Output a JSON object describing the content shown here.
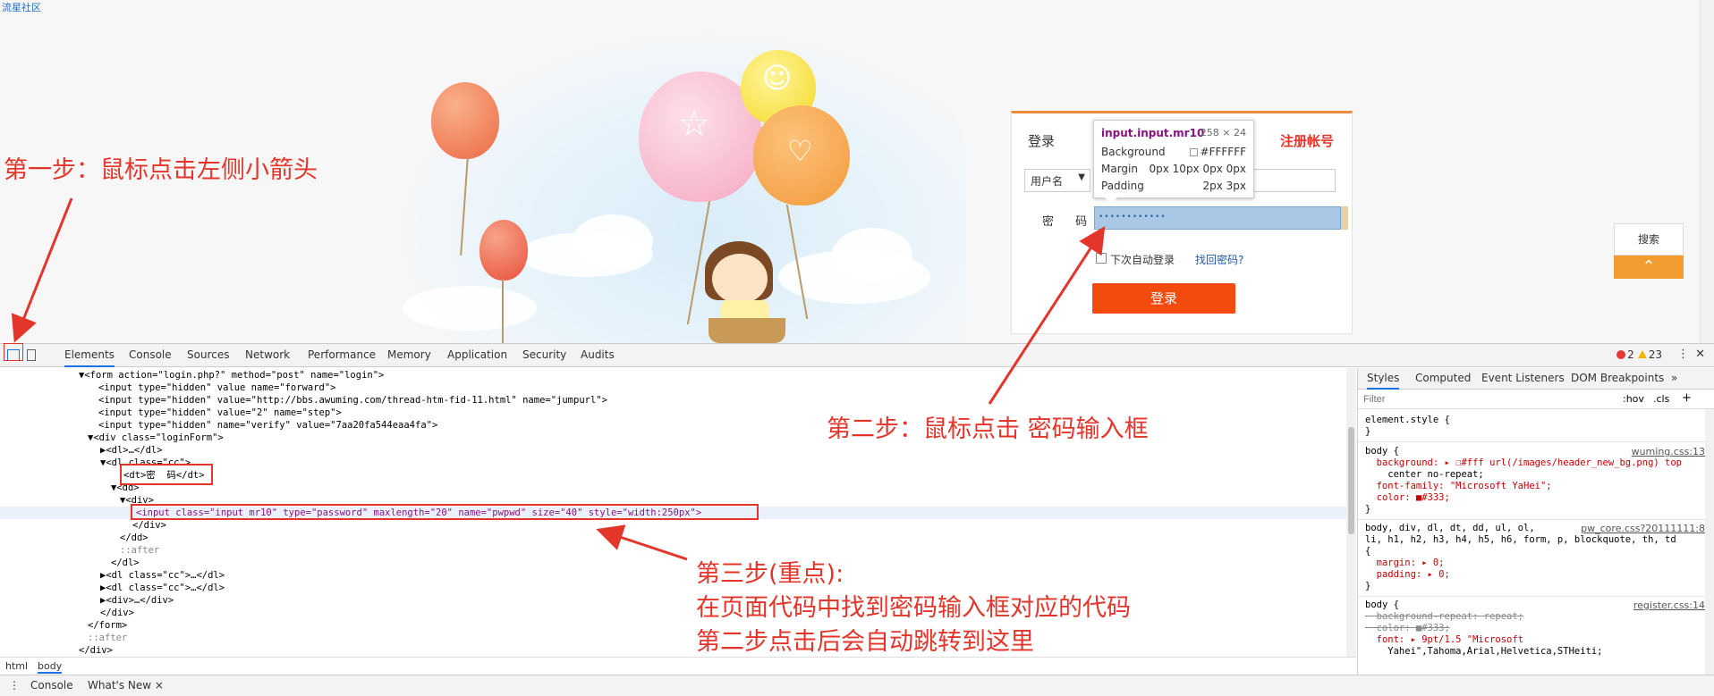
{
  "site": {
    "link_text": "流星社区"
  },
  "login": {
    "title": "登录",
    "register": "注册帐号",
    "select_value": "用户名",
    "password_label": "密 码",
    "password_masked": "••••••••••••",
    "remember": "下次自动登录",
    "forgot": "找回密码?",
    "submit": "登录"
  },
  "tooltip": {
    "selector": "input.input.mr10",
    "size": "258 × 24",
    "rows": [
      {
        "k": "Background",
        "v": "#FFFFFF"
      },
      {
        "k": "Margin",
        "v": "0px 10px 0px 0px"
      },
      {
        "k": "Padding",
        "v": "2px 3px"
      }
    ]
  },
  "side_widget": {
    "search": "搜索",
    "top_arrow": "⌃"
  },
  "devtools": {
    "tabs": [
      "Elements",
      "Console",
      "Sources",
      "Network",
      "Performance",
      "Memory",
      "Application",
      "Security",
      "Audits"
    ],
    "error_count": "2",
    "warning_count": "23",
    "dom_lines": [
      "▼<form action=\"login.php?\" method=\"post\" name=\"login\">",
      "<input type=\"hidden\" value name=\"forward\">",
      "<input type=\"hidden\" value=\"http://bbs.awuming.com/thread-htm-fid-11.html\" name=\"jumpurl\">",
      "<input type=\"hidden\" value=\"2\" name=\"step\">",
      "<input type=\"hidden\" name=\"verify\" value=\"7aa20fa544eaa4fa\">",
      "▼<div class=\"loginForm\">",
      "▶<dl>…</dl>",
      "▼<dl class=\"cc\">",
      "<dt>密  码</dt>",
      "▼<dd>",
      "▼<div>",
      "<input class=\"input mr10\" type=\"password\" maxlength=\"20\" name=\"pwpwd\" size=\"40\" style=\"width:250px\">",
      "</div>",
      "</dd>",
      "::after",
      "</dl>",
      "▶<dl class=\"cc\">…</dl>",
      "▶<dl class=\"cc\">…</dl>",
      "▶<div>…</div>",
      "</div>",
      "</form>",
      "::after",
      "</div>"
    ],
    "breadcrumbs": [
      "html",
      "body"
    ],
    "drawer_tabs": [
      "Console",
      "What's New ×"
    ],
    "styles_tabs": [
      "Styles",
      "Computed",
      "Event Listeners",
      "DOM Breakpoints",
      "»"
    ],
    "filter_placeholder": "Filter",
    "filter_toggles": [
      ":hov",
      ".cls",
      "+"
    ],
    "rules": [
      {
        "lines": [
          "element.style {",
          "}"
        ],
        "src": ""
      },
      {
        "lines": [
          "body {",
          "  background: ▸ ☐#fff url(/images/header_new_bg.png) top",
          "    center no-repeat;",
          "  font-family: \"Microsoft YaHei\";",
          "  color: ■#333;",
          "}"
        ],
        "src": "wuming.css:13"
      },
      {
        "lines": [
          "body, div, dl, dt, dd, ul, ol,",
          "li, h1, h2, h3, h4, h5, h6, form, p, blockquote, th, td",
          "{",
          "  margin: ▸ 0;",
          "  padding: ▸ 0;",
          "}"
        ],
        "src": "pw_core.css?20111111:8"
      },
      {
        "lines": [
          "body {",
          "  background-repeat: repeat;",
          "  color: ■#333;",
          "  font: ▸ 9pt/1.5 \"Microsoft",
          "    Yahei\",Tahoma,Arial,Helvetica,STHeiti;"
        ],
        "src": "register.css:14"
      }
    ]
  },
  "annotations": {
    "step1": "第一步：鼠标点击左侧小箭头",
    "step2": "第二步：鼠标点击 密码输入框",
    "step3_l1": "第三步(重点):",
    "step3_l2": "在页面代码中找到密码输入框对应的代码",
    "step3_l3": "第二步点击后会自动跳转到这里"
  },
  "colors": {
    "annotation": "#e4352a",
    "login_button": "#f24b0d",
    "accent_orange": "#f08a3c"
  }
}
